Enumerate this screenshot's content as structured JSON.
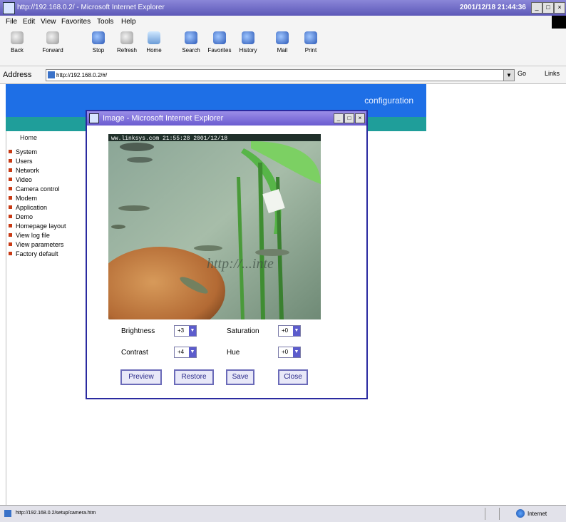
{
  "window": {
    "title": "http://192.168.0.2/ - Microsoft Internet Explorer",
    "clock": "2001/12/18 21:44:36"
  },
  "menu": [
    "File",
    "Edit",
    "View",
    "Favorites",
    "Tools",
    "Help"
  ],
  "toolbar": [
    {
      "label": "Back",
      "icon": "back-arrow-icon"
    },
    {
      "label": "Forward",
      "icon": "forward-arrow-icon"
    },
    {
      "label": "Stop",
      "icon": "stop-icon"
    },
    {
      "label": "Refresh",
      "icon": "refresh-icon"
    },
    {
      "label": "Home",
      "icon": "home-icon"
    },
    {
      "label": "Search",
      "icon": "search-icon"
    },
    {
      "label": "Favorites",
      "icon": "favorites-icon"
    },
    {
      "label": "History",
      "icon": "history-icon"
    },
    {
      "label": "Mail",
      "icon": "mail-icon"
    },
    {
      "label": "Print",
      "icon": "print-icon"
    }
  ],
  "address": {
    "label": "Address",
    "url": "http://192.168.0.2/#/",
    "go": "Go",
    "links": "Links"
  },
  "banner": {
    "text": "configuration"
  },
  "sidebar": {
    "home": "Home",
    "items": [
      "System",
      "Users",
      "Network",
      "Video",
      "Camera control",
      "Modem",
      "Application",
      "Demo",
      "Homepage layout",
      "View log file",
      "View parameters",
      "Factory default"
    ]
  },
  "popup": {
    "title": "Image - Microsoft Internet Explorer",
    "overlay_text": "http://...inte",
    "camera_caption": "ww.linksys.com 21:55:28 2001/12/18",
    "controls": {
      "brightness": {
        "label": "Brightness",
        "value": "+3"
      },
      "saturation": {
        "label": "Saturation",
        "value": "+0"
      },
      "contrast": {
        "label": "Contrast",
        "value": "+4"
      },
      "hue": {
        "label": "Hue",
        "value": "+0"
      }
    },
    "buttons": {
      "preview": "Preview",
      "restore": "Restore",
      "save": "Save",
      "close": "Close"
    }
  },
  "status": {
    "text": "http://192.168.0.2/setup/camera.htm",
    "zone": "Internet"
  }
}
